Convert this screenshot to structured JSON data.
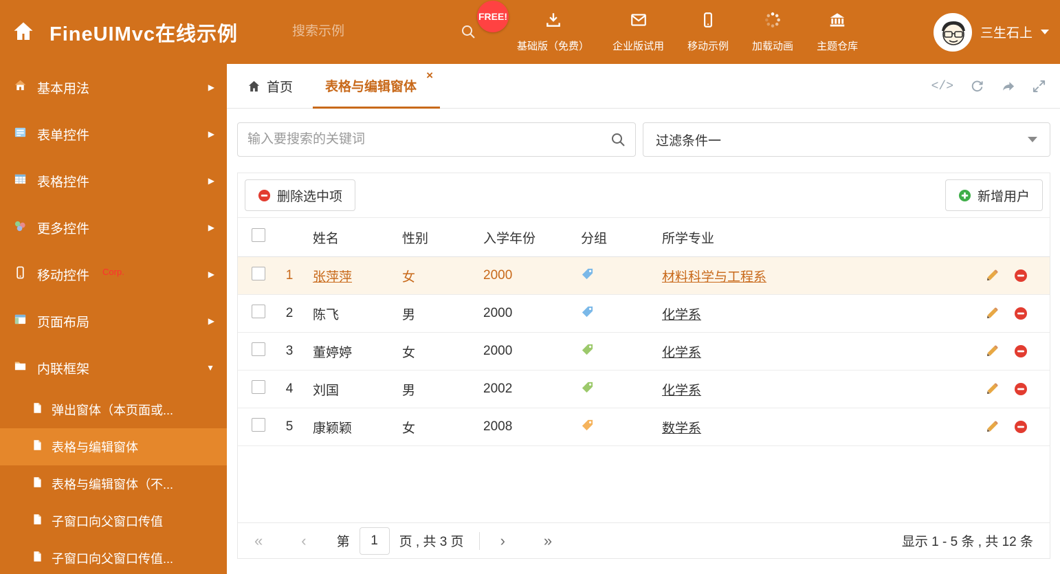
{
  "header": {
    "title": "FineUIMvc在线示例",
    "search_placeholder": "搜索示例",
    "free_badge": "FREE!",
    "nav_items": [
      {
        "label": "基础版（免费）",
        "icon": "download-icon"
      },
      {
        "label": "企业版试用",
        "icon": "envelope-icon"
      },
      {
        "label": "移动示例",
        "icon": "mobile-icon"
      },
      {
        "label": "加载动画",
        "icon": "spinner-icon"
      },
      {
        "label": "主题仓库",
        "icon": "theme-repo-icon"
      }
    ],
    "user_name": "三生石上"
  },
  "sidebar": {
    "items": [
      {
        "label": "基本用法",
        "icon": "home-icon"
      },
      {
        "label": "表单控件",
        "icon": "form-icon"
      },
      {
        "label": "表格控件",
        "icon": "grid-icon"
      },
      {
        "label": "更多控件",
        "icon": "widgets-icon"
      },
      {
        "label": "移动控件",
        "icon": "mobile-icon",
        "badge": "Corp."
      },
      {
        "label": "页面布局",
        "icon": "layout-icon"
      },
      {
        "label": "内联框架",
        "icon": "iframe-icon",
        "expanded": true
      }
    ],
    "subitems": [
      {
        "label": "弹出窗体（本页面或..."
      },
      {
        "label": "表格与编辑窗体",
        "active": true
      },
      {
        "label": "表格与编辑窗体（不..."
      },
      {
        "label": "子窗口向父窗口传值"
      },
      {
        "label": "子窗口向父窗口传值..."
      }
    ]
  },
  "tabs": [
    {
      "label": "首页"
    },
    {
      "label": "表格与编辑窗体",
      "active": true,
      "closable": true
    }
  ],
  "filter": {
    "search_placeholder": "输入要搜索的关键词",
    "dropdown_value": "过滤条件一"
  },
  "toolbar": {
    "delete_button": "删除选中项",
    "add_button": "新增用户"
  },
  "table": {
    "columns": [
      "姓名",
      "性别",
      "入学年份",
      "分组",
      "所学专业"
    ],
    "rows": [
      {
        "index": "1",
        "name": "张萍萍",
        "gender": "女",
        "year": "2000",
        "tag_color": "blue",
        "major": "材料科学与工程系",
        "selected": true
      },
      {
        "index": "2",
        "name": "陈飞",
        "gender": "男",
        "year": "2000",
        "tag_color": "blue",
        "major": "化学系"
      },
      {
        "index": "3",
        "name": "董婷婷",
        "gender": "女",
        "year": "2000",
        "tag_color": "green",
        "major": "化学系"
      },
      {
        "index": "4",
        "name": "刘国",
        "gender": "男",
        "year": "2002",
        "tag_color": "green",
        "major": "化学系"
      },
      {
        "index": "5",
        "name": "康颖颖",
        "gender": "女",
        "year": "2008",
        "tag_color": "orange",
        "major": "数学系"
      }
    ]
  },
  "pagination": {
    "page_label_prefix": "第",
    "page_value": "1",
    "page_label_suffix": "页 , 共 3 页",
    "summary": "显示 1 - 5 条 , 共 12 条"
  },
  "colors": {
    "header_bg": "#d2711c",
    "active_accent": "#c8691a",
    "selected_row_bg": "#fdf5e8",
    "free_badge_bg": "#ff4242",
    "danger": "#e23c30",
    "success": "#3fae49",
    "tags": {
      "blue": "#7ab8e8",
      "green": "#9cc96b",
      "orange": "#f5b35c"
    }
  }
}
